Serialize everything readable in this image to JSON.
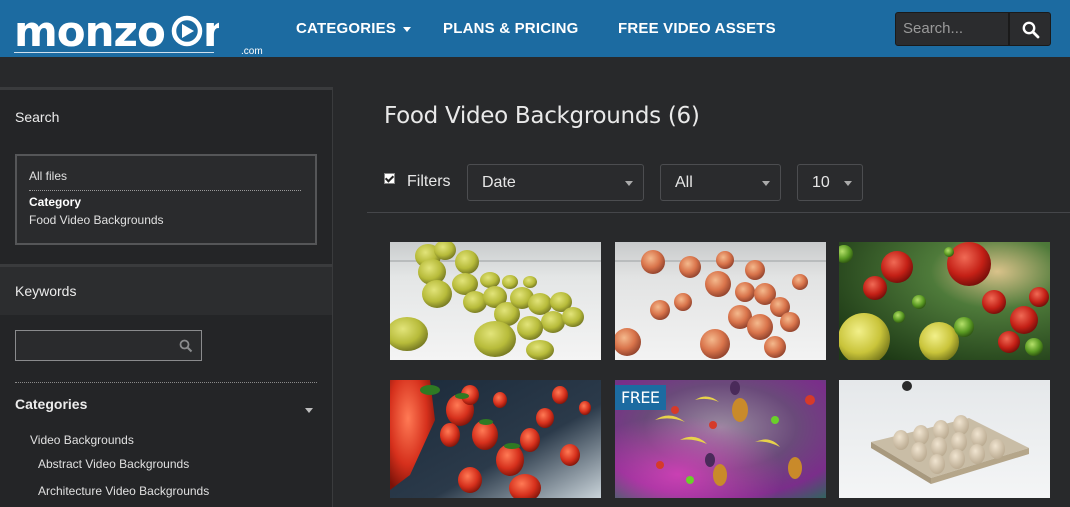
{
  "header": {
    "logo": "monzoom",
    "logo_suffix": ".com",
    "nav": [
      {
        "label": "CATEGORIES"
      },
      {
        "label": "PLANS & PRICING"
      },
      {
        "label": "FREE VIDEO ASSETS"
      }
    ],
    "search_placeholder": "Search...",
    "search_icon": "magnifier-icon"
  },
  "sidebar": {
    "search_title": "Search",
    "active_filters": {
      "all_files": "All files",
      "category_label": "Category",
      "category_value": "Food Video Backgrounds"
    },
    "keywords_title": "Keywords",
    "keywords_value": "",
    "categories_title": "Categories",
    "categories": [
      {
        "label": "Video Backgrounds"
      },
      {
        "label": "Abstract Video Backgrounds"
      },
      {
        "label": "Architecture Video Backgrounds"
      }
    ]
  },
  "main": {
    "title": "Food Video Backgrounds (6)",
    "filters_label": "Filters",
    "filters_checked": true,
    "sort": {
      "selected": "Date"
    },
    "type": {
      "selected": "All"
    },
    "per_page": {
      "selected": "10"
    },
    "thumbnails": [
      {
        "name": "lemons",
        "badge": ""
      },
      {
        "name": "peaches",
        "badge": ""
      },
      {
        "name": "apples",
        "badge": ""
      },
      {
        "name": "strawberries",
        "badge": ""
      },
      {
        "name": "mixed-fruit",
        "badge": "FREE"
      },
      {
        "name": "egg-carton",
        "badge": ""
      }
    ]
  },
  "colors": {
    "header_bg": "#1c6ba1",
    "page_bg": "#28292b",
    "sidebar_bg": "#242527",
    "badge_bg": "#1c6ba1"
  }
}
